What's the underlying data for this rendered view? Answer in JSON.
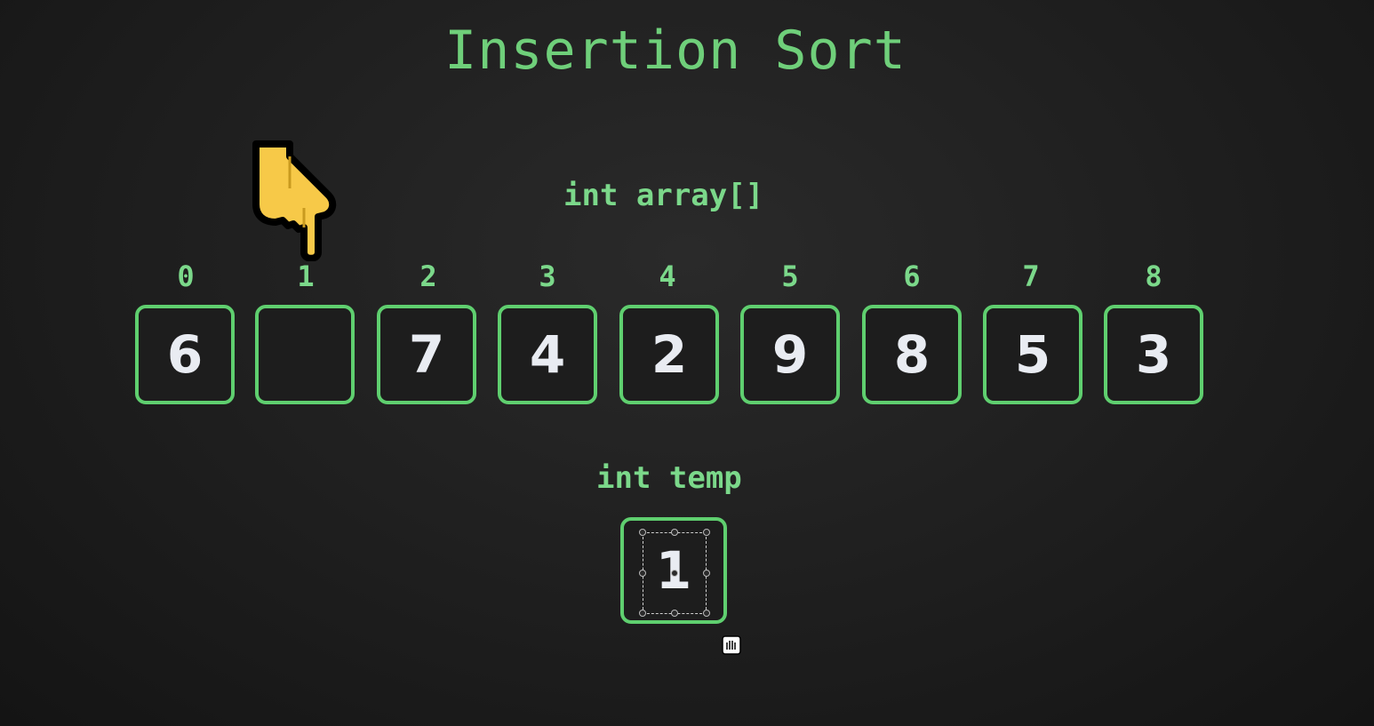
{
  "title": "Insertion Sort",
  "array_label": "int array[]",
  "temp_label": "int temp",
  "indices": [
    "0",
    "1",
    "2",
    "3",
    "4",
    "5",
    "6",
    "7",
    "8"
  ],
  "cells": [
    "6",
    "",
    "7",
    "4",
    "2",
    "9",
    "8",
    "5",
    "3"
  ],
  "temp_value": "1",
  "pointer": {
    "icon": "pointing-hand-icon",
    "index": 1
  },
  "colors": {
    "accent": "#7bd88a",
    "border": "#5fcf6f",
    "value": "#e9ecf2",
    "pointer": "#f7c948"
  }
}
